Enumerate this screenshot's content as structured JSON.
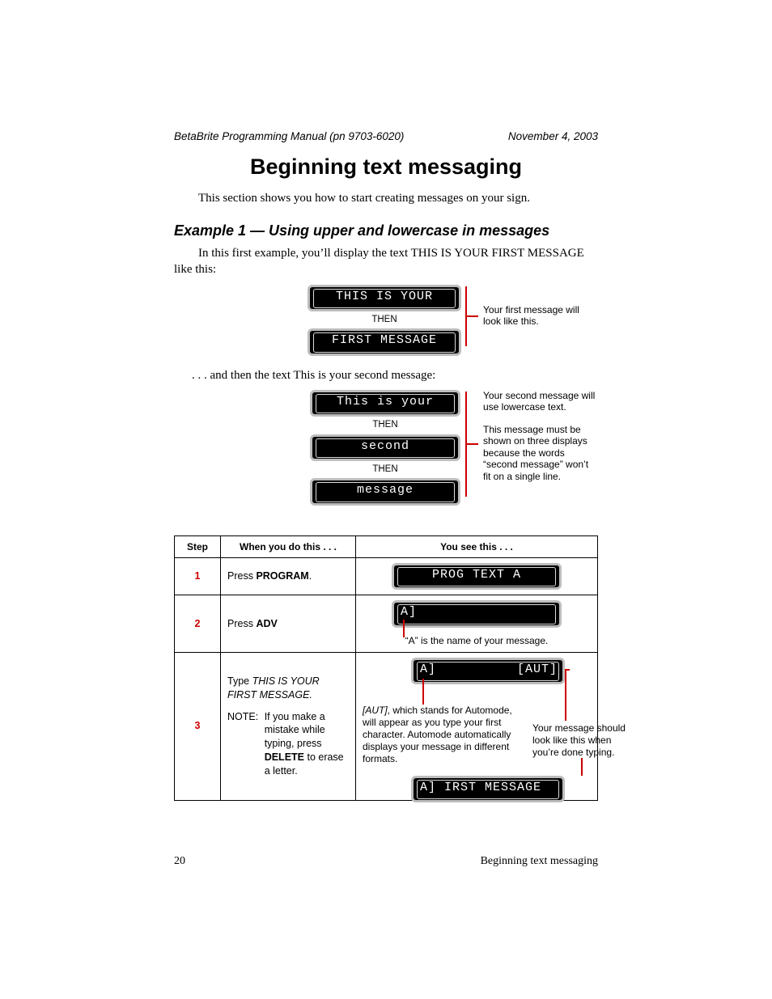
{
  "running": {
    "left": "BetaBrite Programming Manual (pn 9703-6020)",
    "right": "November 4, 2003"
  },
  "title": "Beginning text messaging",
  "intro": "This section shows you how to start creating messages on your sign.",
  "example_heading": "Example 1 — Using upper and lowercase in messages",
  "para1a": "In this first example, you’ll display the text THIS IS YOUR FIRST MESSAGE like this:",
  "demo1": {
    "sign1": "THIS IS YOUR",
    "then": "THEN",
    "sign2": "FIRST MESSAGE",
    "callout": "Your first message will look like this."
  },
  "para2": ". . . and then the text This is your second message:",
  "demo2": {
    "sign1": "This is your",
    "then1": "THEN",
    "sign2": "second",
    "then2": "THEN",
    "sign3": "message",
    "callout1": "Your second message will use lowercase text.",
    "callout2": "This message must be shown on three displays because the words “second message” won’t fit on a single line."
  },
  "table": {
    "head_step": "Step",
    "head_action": "When you do this . . .",
    "head_result": "You see this . . .",
    "rows": [
      {
        "n": "1",
        "action_pre": "Press ",
        "action_bold": "PROGRAM",
        "action_post": ".",
        "sign": "PROG TEXT A"
      },
      {
        "n": "2",
        "action_pre": "Press ",
        "action_bold": "ADV",
        "action_post": "",
        "sign_left": "A]",
        "caption": "“A” is the name of your message."
      },
      {
        "n": "3",
        "sign_top_left": "A]",
        "sign_top_right": "[AUT]",
        "sign_bot": "A] IRST MESSAGE",
        "leftnote_pre": "[AUT]",
        "leftnote_body": ", which stands for Automode, will appear as you type your first character. Automode automatically displays your message in different formats.",
        "rightnote": "Your message should look like this when you’re done typing.",
        "action_type_pre": "Type ",
        "action_type_ital": "THIS IS YOUR FIRST MESSAGE.",
        "action_note_lead": "NOTE:",
        "action_note_a": "If you make a mistake while typing, press ",
        "action_note_bold": "DELETE",
        "action_note_b": " to erase a letter."
      }
    ]
  },
  "footer": {
    "page": "20",
    "section": "Beginning text messaging"
  }
}
